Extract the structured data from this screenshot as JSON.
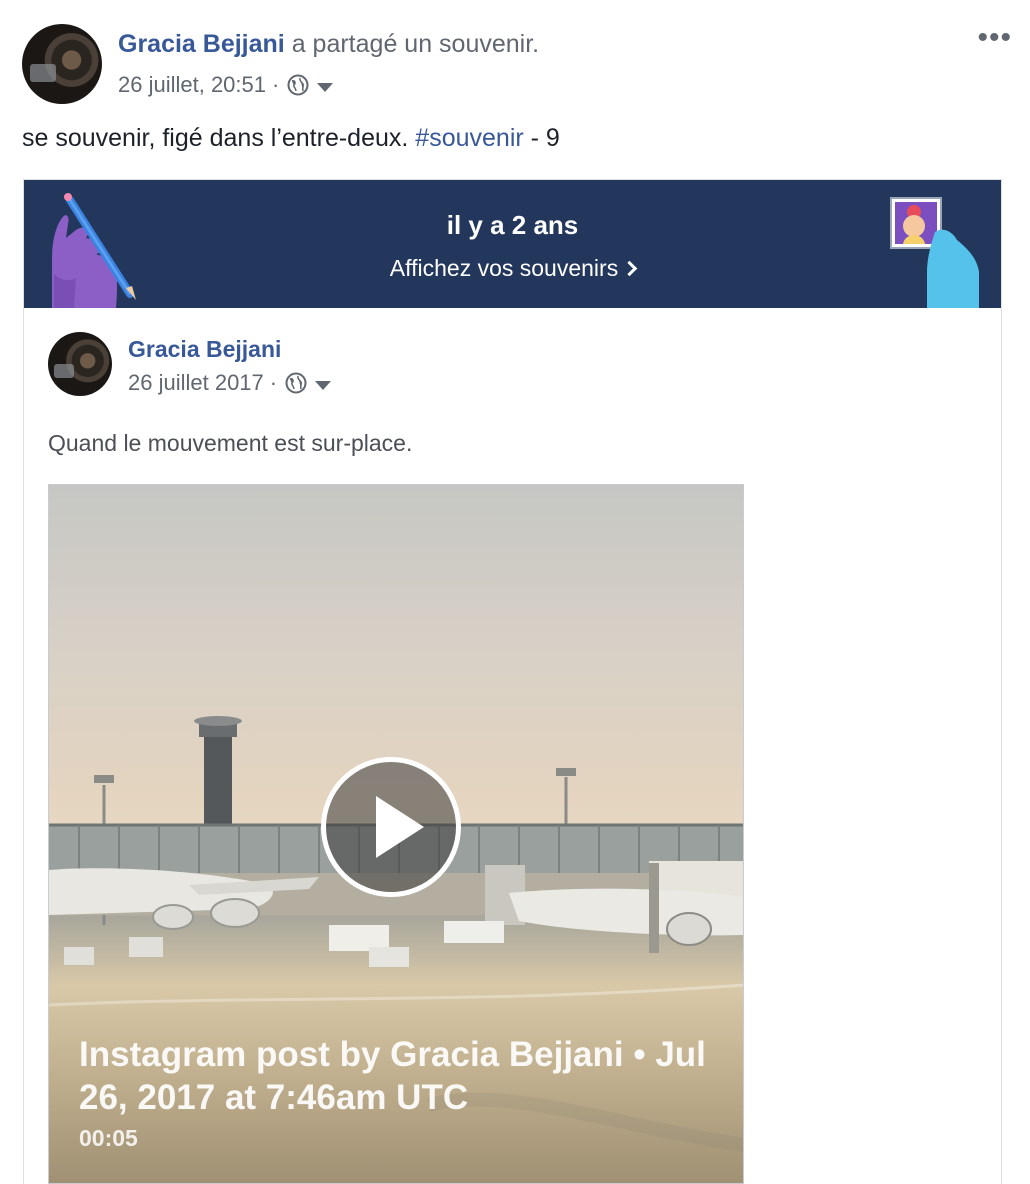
{
  "post": {
    "author": "Gracia Bejjani",
    "action": "a partagé un souvenir.",
    "timestamp": "26 juillet, 20:51",
    "meta_separator": "·",
    "privacy_icon": "globe-icon",
    "options_label": "•••",
    "text_before": "se souvenir, figé dans l’entre-deux.",
    "hashtag": "#souvenir",
    "text_after": "- 9"
  },
  "memory_banner": {
    "title": "il y a 2 ans",
    "link_label": "Affichez vos souvenirs",
    "background": "#23375c"
  },
  "shared_post": {
    "author": "Gracia Bejjani",
    "date": "26 juillet 2017",
    "meta_separator": "·",
    "text": "Quand le mouvement est sur-place.",
    "video": {
      "title": "Instagram post by Gracia Bejjani • Jul 26, 2017 at 7:46am UTC",
      "duration": "00:05"
    }
  },
  "colors": {
    "link": "#385898",
    "secondary_text": "#606770",
    "primary_text": "#1d2129"
  }
}
